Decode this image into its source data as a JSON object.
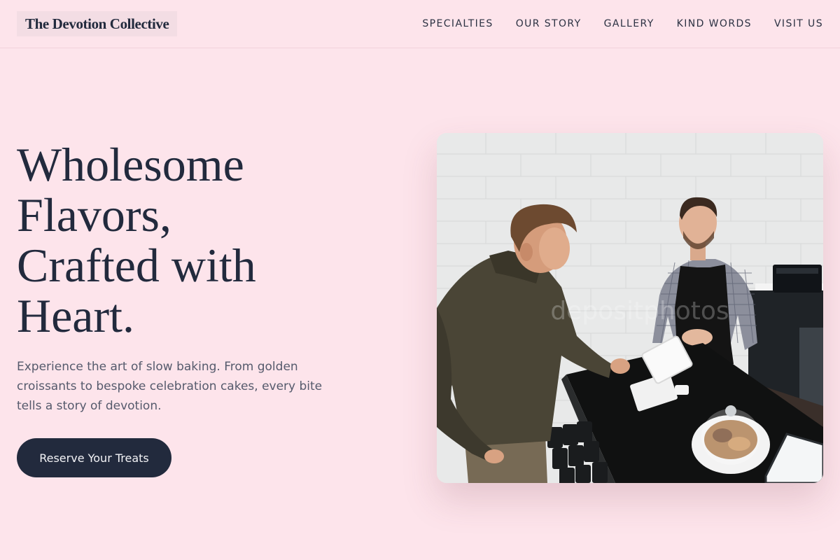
{
  "header": {
    "brand": "The Devotion Collective",
    "nav": [
      {
        "label": "SPECIALTIES"
      },
      {
        "label": "OUR STORY"
      },
      {
        "label": "GALLERY"
      },
      {
        "label": "KIND WORDS"
      },
      {
        "label": "VISIT US"
      }
    ]
  },
  "hero": {
    "title_lines": [
      "Wholesome",
      "Flavors,",
      "Crafted with",
      "Heart."
    ],
    "subtitle": "Experience the art of slow baking. From golden croissants to bespoke celebration cakes, every bite tells a story of devotion.",
    "cta_label": "Reserve Your Treats",
    "photo_watermark": "depositphotos"
  },
  "colors": {
    "background": "#fde4eb",
    "ink": "#222a3d",
    "brand_highlight": "#f3dde4",
    "muted_text": "#555a6c"
  }
}
